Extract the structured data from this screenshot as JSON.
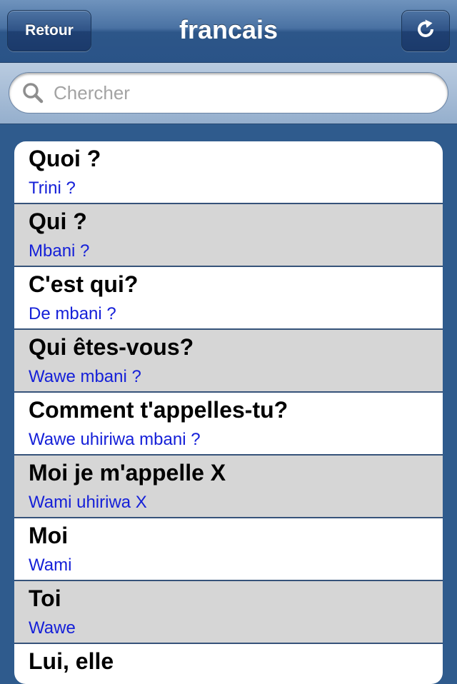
{
  "navbar": {
    "back_label": "Retour",
    "title": "francais",
    "refresh_icon": "refresh-icon"
  },
  "search": {
    "placeholder": "Chercher",
    "value": "",
    "icon": "search-icon"
  },
  "colors": {
    "nav_blue": "#2f5b8d",
    "row_alt": "#d6d6d6",
    "translation_blue": "#1520d8"
  },
  "phrases": [
    {
      "french": "Quoi ?",
      "translation": "Trini ?"
    },
    {
      "french": "Qui ?",
      "translation": "Mbani ?"
    },
    {
      "french": "C'est qui?",
      "translation": "De mbani ?"
    },
    {
      "french": "Qui êtes-vous?",
      "translation": "Wawe mbani ?"
    },
    {
      "french": "Comment t'appelles-tu?",
      "translation": "Wawe uhiriwa mbani ?"
    },
    {
      "french": "Moi je m'appelle X",
      "translation": "Wami uhiriwa X"
    },
    {
      "french": "Moi",
      "translation": "Wami"
    },
    {
      "french": "Toi",
      "translation": "Wawe"
    },
    {
      "french": "Lui, elle",
      "translation": ""
    }
  ]
}
